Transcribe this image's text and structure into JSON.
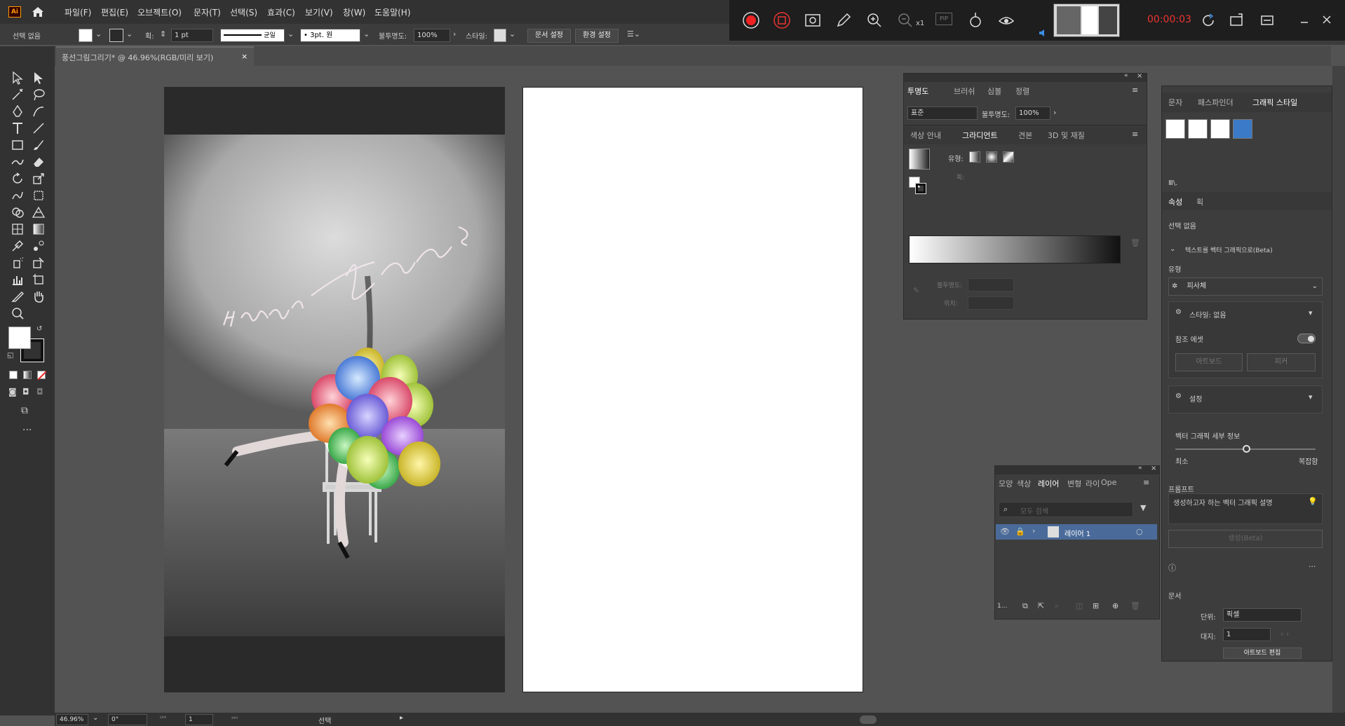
{
  "menu": {
    "app_logo": "Ai",
    "items": [
      "파일(F)",
      "편집(E)",
      "오브젝트(O)",
      "문자(T)",
      "선택(S)",
      "효과(C)",
      "보기(V)",
      "창(W)",
      "도움말(H)"
    ]
  },
  "recorder": {
    "time": "00:00:03",
    "zoom_label": "x1",
    "pip_label": "PIP"
  },
  "control": {
    "selection": "선택 없음",
    "stroke_label": "획:",
    "stroke_value": "1 pt",
    "uniform": "균일",
    "brush": "3pt. 원",
    "opacity_label": "불투명도:",
    "opacity_value": "100%",
    "style_label": "스타일:",
    "doc_settings": "문서 설정",
    "preferences": "환경 설정"
  },
  "document_tab": {
    "title": "풍선그림그리기* @ 46.96%(RGB/미리 보기)",
    "close": "×"
  },
  "canvas": {
    "handwriting": "Happy B-day"
  },
  "transparency_panel": {
    "tabs": [
      "투명도",
      "브러쉬",
      "심볼",
      "정렬"
    ],
    "blend_mode": "표준",
    "opacity_label": "불투명도:",
    "opacity_value": "100%"
  },
  "gradient_panel": {
    "tabs": [
      "색상 안내",
      "그라디언트",
      "견본",
      "3D 및 재질"
    ],
    "type_label": "유형:",
    "stroke_label": "획:",
    "opacity_label": "불투명도:",
    "location_label": "위치:"
  },
  "layers_panel": {
    "tabs": [
      "모양",
      "색상",
      "레이어",
      "변형",
      "라이",
      "Ope"
    ],
    "search_placeholder": "모두 검색",
    "layer_name": "레이어 1",
    "count": "1..."
  },
  "properties_panel": {
    "top_tabs": [
      "문자",
      "패스파인더",
      "그래픽 스타일"
    ],
    "sub_label": "Ⅲ\\.",
    "tabs": [
      "속성",
      "획"
    ],
    "no_selection": "선택 없음",
    "section_text_to_vector": "텍스트를 벡터 그래픽으로(Beta)",
    "type_label": "유형",
    "type_value": "피사체",
    "style_label": "스타일: 없음",
    "reference_asset": "참조 에셋",
    "artboard_btn": "아트보드",
    "pick_btn": "피커",
    "settings_label": "설정",
    "detail_label": "벡터 그래픽 세부 정보",
    "min_label": "최소",
    "max_label": "복잡함",
    "prompt_label": "프롬프트",
    "prompt_placeholder": "생성하고자 하는 벡터 그래픽 설명",
    "generate_btn": "생성(Beta)",
    "document_label": "문서",
    "unit_label": "단위:",
    "unit_value": "픽셀",
    "artboard_label": "대지:",
    "artboard_value": "1",
    "edit_artboard": "아트보드 편집"
  },
  "status": {
    "zoom": "46.96%",
    "rotation": "0°",
    "page": "1",
    "mode": "선택"
  }
}
